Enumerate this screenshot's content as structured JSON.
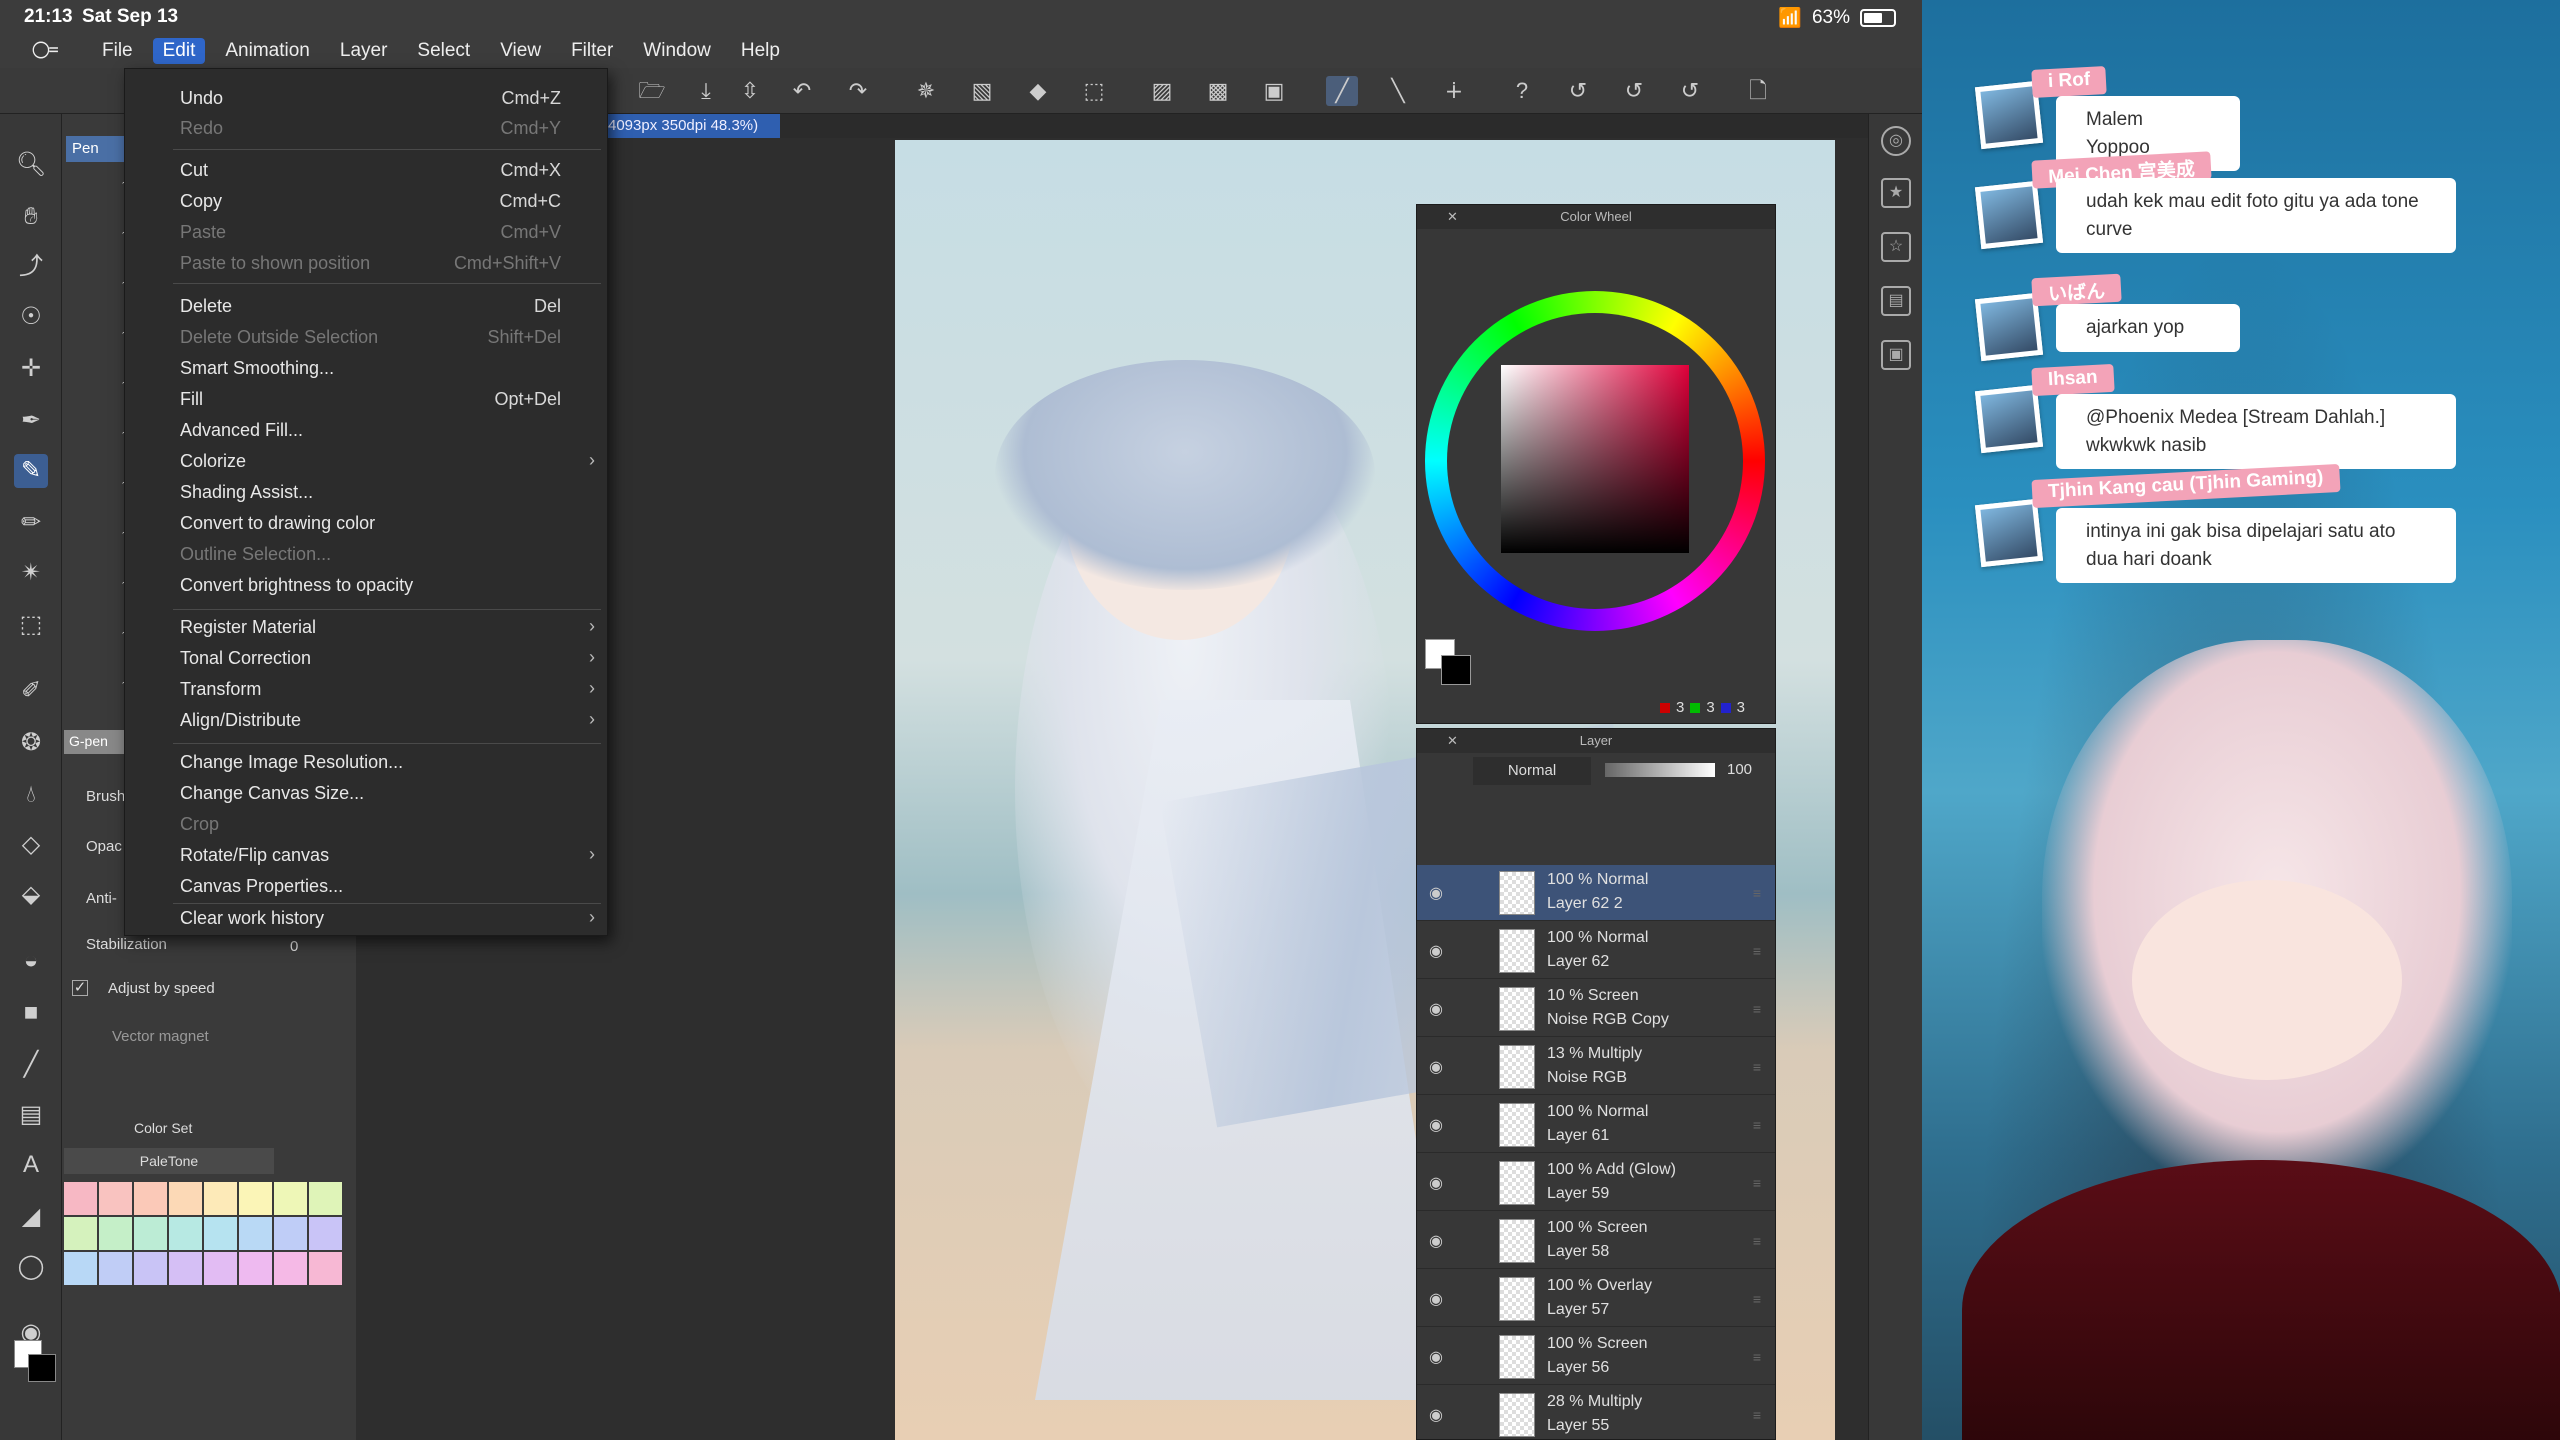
{
  "status": {
    "time": "21:13",
    "date": "Sat Sep 13",
    "battery": "63%"
  },
  "menubar": {
    "items": [
      "File",
      "Edit",
      "Animation",
      "Layer",
      "Select",
      "View",
      "Filter",
      "Window",
      "Help"
    ],
    "active": "Edit"
  },
  "canvas_info": "4093px 350dpi 48.3%)",
  "edit_menu": [
    {
      "label": "Undo",
      "shortcut": "Cmd+Z",
      "enabled": true
    },
    {
      "label": "Redo",
      "shortcut": "Cmd+Y",
      "enabled": false
    },
    {
      "label": "Cut",
      "shortcut": "Cmd+X",
      "enabled": true
    },
    {
      "label": "Copy",
      "shortcut": "Cmd+C",
      "enabled": true
    },
    {
      "label": "Paste",
      "shortcut": "Cmd+V",
      "enabled": false
    },
    {
      "label": "Paste to shown position",
      "shortcut": "Cmd+Shift+V",
      "enabled": false
    },
    {
      "label": "Delete",
      "shortcut": "Del",
      "enabled": true
    },
    {
      "label": "Delete Outside Selection",
      "shortcut": "Shift+Del",
      "enabled": false
    },
    {
      "label": "Smart Smoothing...",
      "shortcut": "",
      "enabled": true
    },
    {
      "label": "Fill",
      "shortcut": "Opt+Del",
      "enabled": true
    },
    {
      "label": "Advanced Fill...",
      "shortcut": "",
      "enabled": true
    },
    {
      "label": "Colorize",
      "shortcut": "",
      "enabled": true,
      "submenu": true
    },
    {
      "label": "Shading Assist...",
      "shortcut": "",
      "enabled": true
    },
    {
      "label": "Convert to drawing color",
      "shortcut": "",
      "enabled": true
    },
    {
      "label": "Outline Selection...",
      "shortcut": "",
      "enabled": false
    },
    {
      "label": "Convert brightness to opacity",
      "shortcut": "",
      "enabled": true
    },
    {
      "label": "Register Material",
      "shortcut": "",
      "enabled": true,
      "submenu": true
    },
    {
      "label": "Tonal Correction",
      "shortcut": "",
      "enabled": true,
      "submenu": true
    },
    {
      "label": "Transform",
      "shortcut": "",
      "enabled": true,
      "submenu": true
    },
    {
      "label": "Align/Distribute",
      "shortcut": "",
      "enabled": true,
      "submenu": true
    },
    {
      "label": "Change Image Resolution...",
      "shortcut": "",
      "enabled": true
    },
    {
      "label": "Change Canvas Size...",
      "shortcut": "",
      "enabled": true
    },
    {
      "label": "Crop",
      "shortcut": "",
      "enabled": false
    },
    {
      "label": "Rotate/Flip canvas",
      "shortcut": "",
      "enabled": true,
      "submenu": true
    },
    {
      "label": "Canvas Properties...",
      "shortcut": "",
      "enabled": true
    },
    {
      "label": "Clear work history",
      "shortcut": "",
      "enabled": true,
      "submenu": true
    }
  ],
  "subtool": {
    "header": "Pen",
    "gpen_label": "G-pen",
    "brush_label": "Brush",
    "opacity_label": "Opac",
    "anti_label": "Anti-",
    "stabilization_label": "Stabilization",
    "stabilization_value": "0",
    "adjust_speed_label": "Adjust by speed",
    "vector_magnet_label": "Vector magnet"
  },
  "colorset": {
    "title": "Color Set",
    "preset": "PaleTone",
    "swatches": [
      "#f7b8c4",
      "#f9c3c0",
      "#fbc9b8",
      "#fcd9b6",
      "#fdeab8",
      "#fbf5b7",
      "#eef7b7",
      "#dff4b8",
      "#d5f2bd",
      "#c5efc8",
      "#bcecd5",
      "#b7e9e3",
      "#b6e3f0",
      "#b9d9f5",
      "#bfcdf7",
      "#c9c4f7",
      "#b8d8f6",
      "#c0cdf6",
      "#c9c4f6",
      "#d5bff5",
      "#e2bcf3",
      "#eebaf0",
      "#f5b9e6",
      "#f7b8d4"
    ]
  },
  "color_wheel": {
    "title": "Color Wheel",
    "r": "3",
    "g": "3",
    "b": "3"
  },
  "layer_panel": {
    "title": "Layer",
    "blend_mode": "Normal",
    "opacity": "100",
    "layers": [
      {
        "mode": "100 % Normal",
        "name": "Layer 62 2",
        "selected": true
      },
      {
        "mode": "100 % Normal",
        "name": "Layer 62"
      },
      {
        "mode": "10 % Screen",
        "name": "Noise RGB Copy"
      },
      {
        "mode": "13 % Multiply",
        "name": "Noise RGB"
      },
      {
        "mode": "100 % Normal",
        "name": "Layer 61"
      },
      {
        "mode": "100 % Add (Glow)",
        "name": "Layer 59"
      },
      {
        "mode": "100 % Screen",
        "name": "Layer 58"
      },
      {
        "mode": "100 % Overlay",
        "name": "Layer 57"
      },
      {
        "mode": "100 % Screen",
        "name": "Layer 56"
      },
      {
        "mode": "28 % Multiply",
        "name": "Layer 55"
      }
    ]
  },
  "chat": [
    {
      "name": "i Rof",
      "message": "Malem Yoppoo"
    },
    {
      "name": "Mei Chen 宫美成",
      "message": "udah kek mau edit foto gitu ya ada tone curve"
    },
    {
      "name": "いばん",
      "message": "ajarkan yop"
    },
    {
      "name": "Ihsan",
      "message": "@Phoenix Medea [Stream Dahlah.] wkwkwk nasib"
    },
    {
      "name": "Tjhin Kang cau (Tjhin Gaming)",
      "message": "intinya ini gak bisa dipelajari satu ato dua hari doank"
    }
  ]
}
